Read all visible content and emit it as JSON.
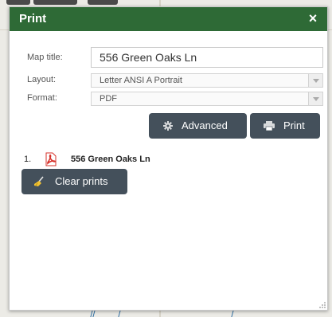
{
  "panel": {
    "title": "Print",
    "close_label": "×"
  },
  "form": {
    "map_title_label": "Map title:",
    "map_title_value": "556 Green Oaks Ln",
    "layout_label": "Layout:",
    "layout_value": "Letter ANSI A Portrait",
    "format_label": "Format:",
    "format_value": "PDF"
  },
  "buttons": {
    "advanced_label": "Advanced",
    "print_label": "Print",
    "clear_label": "Clear prints"
  },
  "prints": [
    {
      "number": "1.",
      "name": "556 Green Oaks Ln",
      "icon": "pdf-icon"
    }
  ],
  "colors": {
    "header": "#2e6a36",
    "button": "#44505b",
    "pdf": "#d6312a"
  },
  "icons": {
    "advanced": "gear-icon",
    "print": "printer-icon",
    "clear": "broom-icon",
    "close": "close-icon"
  }
}
